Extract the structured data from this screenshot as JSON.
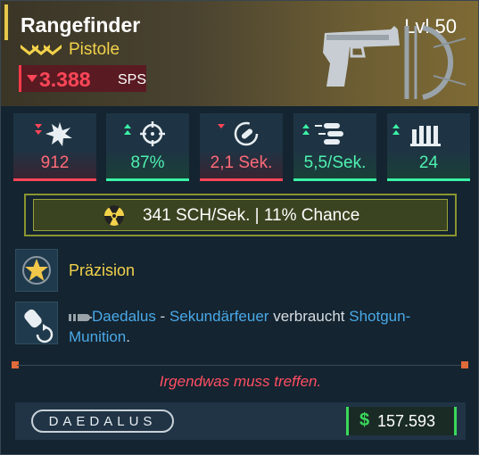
{
  "item": {
    "name": "Rangefinder",
    "level": "Lvl 50",
    "rarity_label": "Pistole",
    "dps_value": "3.388",
    "dps_unit": "SPS"
  },
  "stats": [
    {
      "icon": "damage-burst-icon",
      "value": "912",
      "trend": "down"
    },
    {
      "icon": "crosshair-icon",
      "value": "87%",
      "trend": "up"
    },
    {
      "icon": "reload-icon",
      "value": "2,1 Sek.",
      "trend": "down"
    },
    {
      "icon": "bullets-icon",
      "value": "5,5/Sek.",
      "trend": "up"
    },
    {
      "icon": "magazine-icon",
      "value": "24",
      "trend": "up"
    }
  ],
  "elemental": {
    "icon": "radiation-icon",
    "text": "341 SCH/Sek. | 11% Chance"
  },
  "perks": [
    {
      "icon": "precision-star-icon",
      "text": "Präzision"
    },
    {
      "icon": "grenade-swap-icon",
      "parts": {
        "brand": "Daedalus",
        "sep1": " - ",
        "alt_fire": "Sekundärfeuer",
        "mid": " verbraucht ",
        "ammo": "Shotgun-Munition",
        "end": "."
      }
    }
  ],
  "flavor_text": "Irgendwas muss treffen.",
  "footer": {
    "manufacturer": "DAEDALUS",
    "currency_symbol": "$",
    "price": "157.593"
  },
  "colors": {
    "stat_down": "#ff4658",
    "stat_up": "#3bf2a6",
    "rarity": "#f2d24a",
    "price_accent": "#3ad85a"
  }
}
